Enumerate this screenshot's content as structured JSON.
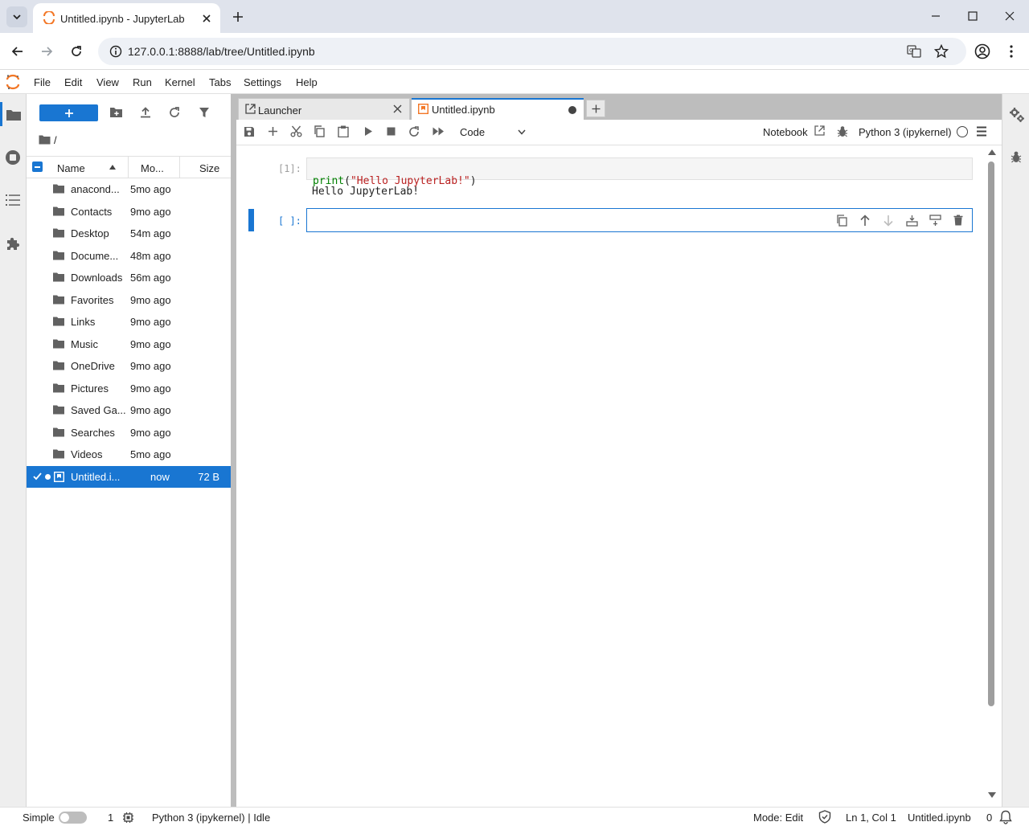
{
  "browser": {
    "tab_title": "Untitled.ipynb - JupyterLab",
    "url": "127.0.0.1:8888/lab/tree/Untitled.ipynb"
  },
  "menu": [
    "File",
    "Edit",
    "View",
    "Run",
    "Kernel",
    "Tabs",
    "Settings",
    "Help"
  ],
  "filebrowser": {
    "path": "/",
    "columns": {
      "name": "Name",
      "modified": "Mo...",
      "size": "Size"
    },
    "items": [
      {
        "name": "anacond...",
        "modified": "5mo ago",
        "size": ""
      },
      {
        "name": "Contacts",
        "modified": "9mo ago",
        "size": ""
      },
      {
        "name": "Desktop",
        "modified": "54m ago",
        "size": ""
      },
      {
        "name": "Docume...",
        "modified": "48m ago",
        "size": ""
      },
      {
        "name": "Downloads",
        "modified": "56m ago",
        "size": ""
      },
      {
        "name": "Favorites",
        "modified": "9mo ago",
        "size": ""
      },
      {
        "name": "Links",
        "modified": "9mo ago",
        "size": ""
      },
      {
        "name": "Music",
        "modified": "9mo ago",
        "size": ""
      },
      {
        "name": "OneDrive",
        "modified": "9mo ago",
        "size": ""
      },
      {
        "name": "Pictures",
        "modified": "9mo ago",
        "size": ""
      },
      {
        "name": "Saved Ga...",
        "modified": "9mo ago",
        "size": ""
      },
      {
        "name": "Searches",
        "modified": "9mo ago",
        "size": ""
      },
      {
        "name": "Videos",
        "modified": "5mo ago",
        "size": ""
      }
    ],
    "selected": {
      "name": "Untitled.i...",
      "modified": "now",
      "size": "72 B"
    }
  },
  "tabs": {
    "launcher": "Launcher",
    "notebook": "Untitled.ipynb"
  },
  "notebook_toolbar": {
    "cell_type": "Code",
    "notebook_link": "Notebook",
    "kernel": "Python 3 (ipykernel)"
  },
  "cells": {
    "cell1_prompt": "[1]:",
    "cell1_code_fn": "print",
    "cell1_code_open": "(",
    "cell1_code_str": "\"Hello JupyterLab!\"",
    "cell1_code_close": ")",
    "cell1_output": "Hello JupyterLab!",
    "cell2_prompt": "[ ]:"
  },
  "status": {
    "mode_label": "Simple",
    "terminals": "1",
    "kernel_status": "Python 3 (ipykernel) | Idle",
    "mode": "Mode: Edit",
    "position": "Ln 1, Col 1",
    "file": "Untitled.ipynb",
    "notifications": "0"
  },
  "colors": {
    "accent": "#1976d2",
    "jupyter_orange": "#f37726",
    "string_red": "#ba2121",
    "builtin_green": "#008000"
  }
}
